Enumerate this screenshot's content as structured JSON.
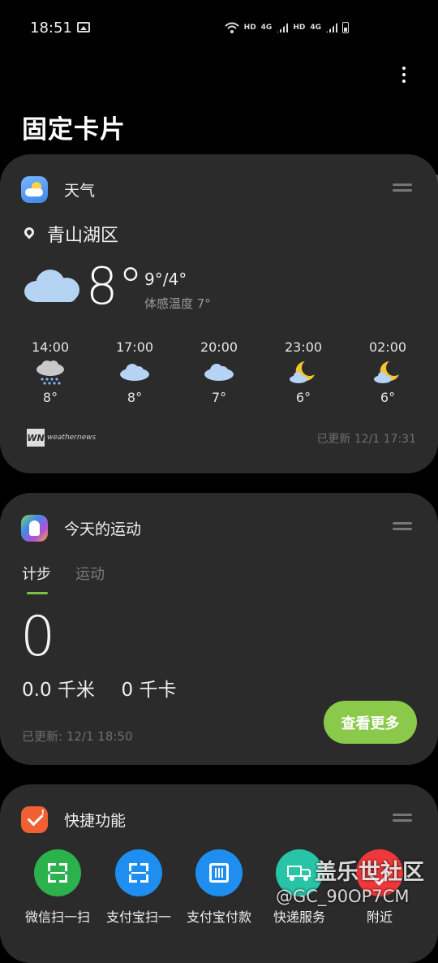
{
  "status_bar": {
    "time": "18:51",
    "network1": "HD",
    "net_type1": "4G",
    "network2": "HD",
    "net_type2": "4G"
  },
  "page": {
    "title": "固定卡片"
  },
  "weather_card": {
    "title": "天气",
    "location": "青山湖区",
    "current_temp": "8°",
    "high_low": "9°/4°",
    "feels_like": "体感温度 7°",
    "forecast": [
      {
        "time": "14:00",
        "icon": "rain-cloud-icon",
        "temp": "8°"
      },
      {
        "time": "17:00",
        "icon": "cloud-icon",
        "temp": "8°"
      },
      {
        "time": "20:00",
        "icon": "cloud-icon",
        "temp": "7°"
      },
      {
        "time": "23:00",
        "icon": "moon-cloud-icon",
        "temp": "6°"
      },
      {
        "time": "02:00",
        "icon": "moon-cloud-icon",
        "temp": "6°"
      }
    ],
    "provider_mark": "WN",
    "provider": "weathernews",
    "updated": "已更新 12/1 17:31"
  },
  "activity_card": {
    "title": "今天的运动",
    "tabs": [
      {
        "label": "计步",
        "active": true
      },
      {
        "label": "运动",
        "active": false
      }
    ],
    "steps": "0",
    "distance": "0.0 千米",
    "calories": "0 千卡",
    "updated": "已更新:  12/1 18:50",
    "more_button": "查看更多"
  },
  "shortcuts_card": {
    "title": "快捷功能",
    "items": [
      {
        "label": "微信扫一扫",
        "color": "#2bb24c",
        "icon": "scan-icon"
      },
      {
        "label": "支付宝扫一",
        "color": "#1e8ff0",
        "icon": "scan-icon"
      },
      {
        "label": "支付宝付款",
        "color": "#1e8ff0",
        "icon": "barcode-icon"
      },
      {
        "label": "快递服务",
        "color": "#27c4a8",
        "icon": "truck-icon"
      },
      {
        "label": "附近",
        "color": "#f0383a",
        "icon": "nearby-icon"
      }
    ]
  },
  "watermark": {
    "line1": "盖乐世社区",
    "line2": "@GC_90OP7CM"
  },
  "colors": {
    "background": "#000000",
    "card": "#2b2b2b",
    "accent_green": "#8bc94a"
  }
}
